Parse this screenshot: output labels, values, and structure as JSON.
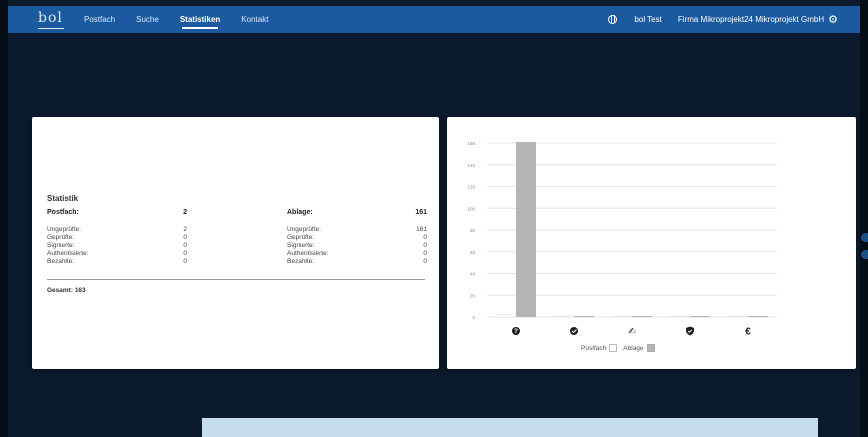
{
  "header": {
    "logo": "bol",
    "nav": [
      {
        "label": "Postfach",
        "active": false
      },
      {
        "label": "Suche",
        "active": false
      },
      {
        "label": "Statistiken",
        "active": true
      },
      {
        "label": "Kontakt",
        "active": false
      }
    ],
    "user": "bol Test",
    "company": "Firma Mikroprojekt24 Mikroprojekt GmbH"
  },
  "statistik": {
    "title": "Statistik",
    "postfach": {
      "label": "Postfach:",
      "total": "2",
      "rows": [
        {
          "label": "Ungeprüfte:",
          "value": "2"
        },
        {
          "label": "Geprüfte:",
          "value": "0"
        },
        {
          "label": "Signierte:",
          "value": "0"
        },
        {
          "label": "Authentisierte:",
          "value": "0"
        },
        {
          "label": "Bezahlte:",
          "value": "0"
        }
      ]
    },
    "ablage": {
      "label": "Ablage:",
      "total": "161",
      "rows": [
        {
          "label": "Ungeprüfte:",
          "value": "161"
        },
        {
          "label": "Geprüfte:",
          "value": "0"
        },
        {
          "label": "Signierte:",
          "value": "0"
        },
        {
          "label": "Authentisierte:",
          "value": "0"
        },
        {
          "label": "Bezahlte:",
          "value": "0"
        }
      ]
    },
    "gesamt": "Gesamt: 163"
  },
  "chart_data": {
    "type": "bar",
    "categories": [
      "question-icon",
      "check-icon",
      "signature-icon",
      "shield-icon",
      "euro-icon"
    ],
    "series": [
      {
        "name": "Postfach",
        "values": [
          2,
          0,
          0,
          0,
          0
        ],
        "color": "#ffffff"
      },
      {
        "name": "Ablage",
        "values": [
          161,
          0,
          0,
          0,
          0
        ],
        "color": "#b5b5b5"
      }
    ],
    "yticks": [
      0,
      20,
      40,
      60,
      80,
      100,
      120,
      140,
      160
    ],
    "ylim": [
      0,
      160
    ],
    "grid": true,
    "legend_position": "bottom-center"
  },
  "colors": {
    "header": "#1c5aa0",
    "background": "#0b1a2c",
    "bar": "#b5b5b5"
  }
}
